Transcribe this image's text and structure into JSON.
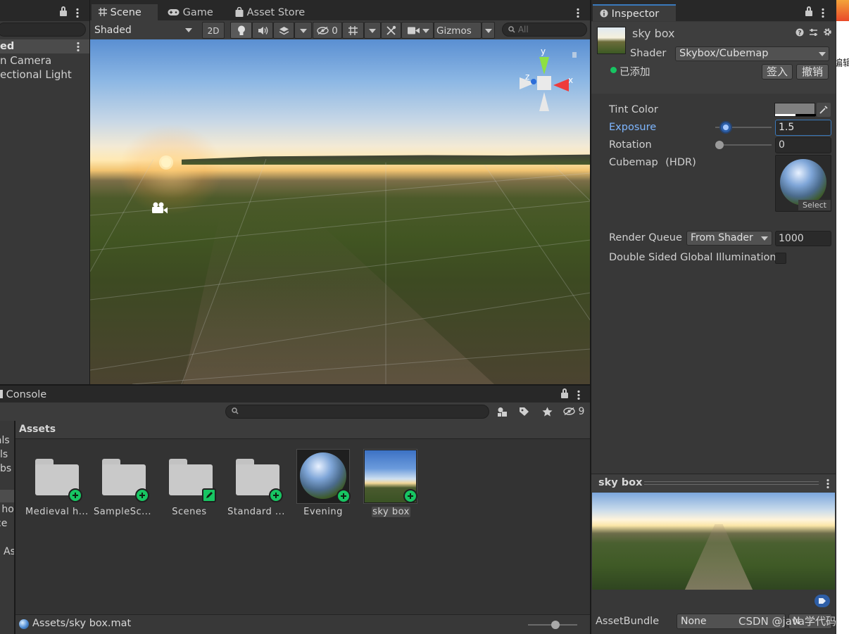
{
  "hierarchy": {
    "partial_title": "ed",
    "items": [
      "n Camera",
      "ectional Light"
    ]
  },
  "scene_view": {
    "tabs": [
      "Scene",
      "Game",
      "Asset Store"
    ],
    "shading_mode": "Shaded",
    "mode_2d": "2D",
    "hidden_count": "0",
    "gizmos_label": "Gizmos",
    "search_placeholder": "All",
    "axis_labels": {
      "y": "y",
      "z": "z",
      "x": "x"
    }
  },
  "inspector": {
    "tab_label": "Inspector",
    "material_name": "sky box",
    "shader_label": "Shader",
    "shader_value": "Skybox/Cubemap",
    "added_label": "已添加",
    "checkin_button": "签入",
    "revert_button": "撤销",
    "properties": {
      "tint_label": "Tint Color",
      "exposure_label": "Exposure",
      "exposure_value": "1.5",
      "exposure_fraction": 0.19,
      "rotation_label": "Rotation",
      "rotation_value": "0",
      "rotation_fraction": 0,
      "cubemap_label": "Cubemap",
      "cubemap_hdr": "(HDR)",
      "cubemap_select": "Select",
      "render_queue_label": "Render Queue",
      "render_queue_mode": "From Shader",
      "render_queue_value": "1000",
      "double_sided_label": "Double Sided Global Illumination",
      "double_sided_checked": false
    },
    "preview_title": "sky box",
    "assetbundle_label": "AssetBundle",
    "assetbundle_value": "None",
    "assetbundle_variant_partial": "N"
  },
  "project": {
    "console_tab": "Console",
    "hidden_count": "9",
    "breadcrumb": "Assets",
    "left_tree_partial": [
      "ials",
      "ls",
      "bs",
      "l ho",
      "ce",
      "As"
    ],
    "assets": [
      {
        "name": "Medieval h...",
        "kind": "folder",
        "badge": "add"
      },
      {
        "name": "SampleSc...",
        "kind": "folder",
        "badge": "add"
      },
      {
        "name": "Scenes",
        "kind": "folder",
        "badge": "edit"
      },
      {
        "name": "Standard ...",
        "kind": "folder",
        "badge": "add"
      },
      {
        "name": "Evening",
        "kind": "cubemap",
        "badge": "add"
      },
      {
        "name": "sky box",
        "kind": "material",
        "badge": "add",
        "selected": true
      }
    ],
    "status_path": "Assets/sky box.mat"
  },
  "right_edge_partial": "编辑",
  "watermark": "CSDN @java学代码",
  "colors": {
    "accent_blue": "#7eb6ff",
    "badge_green": "#17c562",
    "panel_bg": "#383838",
    "toolbar_bg": "#3c3c3c"
  }
}
